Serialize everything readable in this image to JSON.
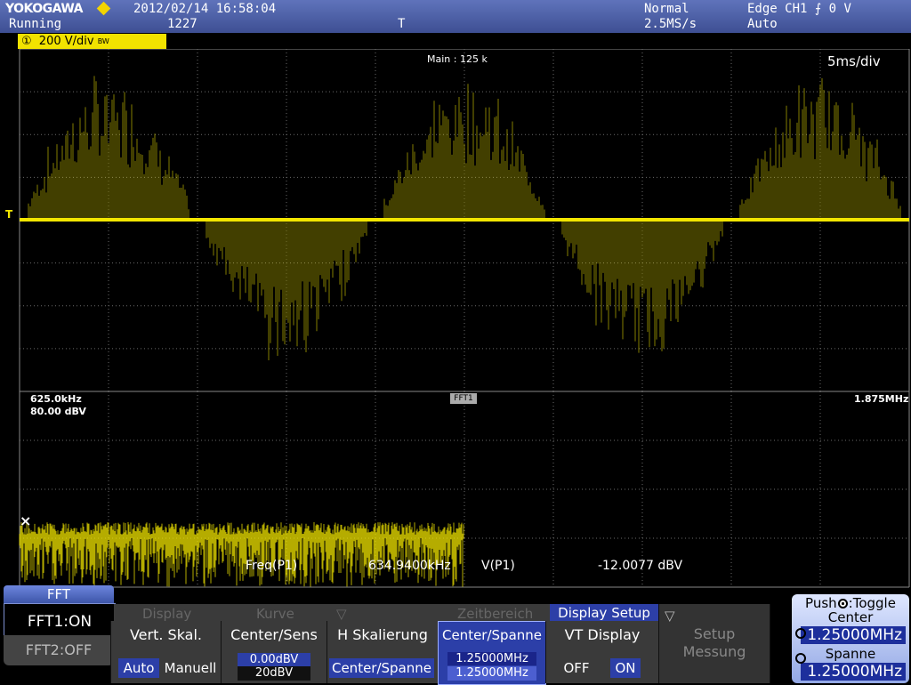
{
  "header": {
    "logo": "YOKOGAWA",
    "status": "Running",
    "datetime": "2012/02/14 16:58:04",
    "acq_count": "1227",
    "trigger_marker": "T",
    "acq_mode": "Normal",
    "sample_rate": "2.5MS/s",
    "trigger_source": "Edge CH1 ⨍ 0 V",
    "trigger_mode": "Auto"
  },
  "channel": {
    "number": "①",
    "scale": "200 V/div",
    "suffix": "BW"
  },
  "waveform": {
    "main_label": "Main : 125 k",
    "timebase": "5ms/div",
    "trigger_level_marker": "T"
  },
  "fft_window": {
    "start_freq": "625.0kHz",
    "ref_level": "80.00 dBV",
    "label": "FFT1",
    "end_freq": "1.875MHz",
    "marker_symbol": "×",
    "meas_freq_label": "Freq(P1)",
    "meas_freq_value": "634.9400kHz",
    "meas_v_label": "V(P1)",
    "meas_v_value": "-12.0077 dBV"
  },
  "menu": {
    "fft_tab": "FFT",
    "fft1": "FFT1:ON",
    "fft2": "FFT2:OFF",
    "ghost_tabs": [
      "Display",
      "Kurve",
      "▽",
      "Zeitbereich"
    ],
    "setup_tab": "Display Setup",
    "buttons": {
      "vert_scale": {
        "title": "Vert. Skal.",
        "opt_auto": "Auto",
        "opt_manual": "Manuell"
      },
      "center_sens": {
        "title": "Center/Sens",
        "center": "0.00dBV",
        "sens": "20dBV"
      },
      "h_scale": {
        "title": "H Skalierung",
        "value": "Center/Spanne"
      },
      "center_span": {
        "title": "Center/Spanne",
        "center": "1.25000MHz",
        "span": "1.25000MHz"
      },
      "vt_display": {
        "title": "VT Display",
        "off": "OFF",
        "on": "ON"
      },
      "setup_measure": {
        "arrow": "▽",
        "line1": "Setup",
        "line2": "Messung"
      }
    }
  },
  "knob_panel": {
    "push_label": "Push",
    "toggle_label": ":Toggle",
    "center_label": "Center",
    "center_value": "1.25000MHz",
    "span_label": "Spanne",
    "span_value": "1.25000MHz"
  },
  "colors": {
    "trace": "#f2e600",
    "grid": "#6a6a6a",
    "accent": "#2c3fa8"
  }
}
